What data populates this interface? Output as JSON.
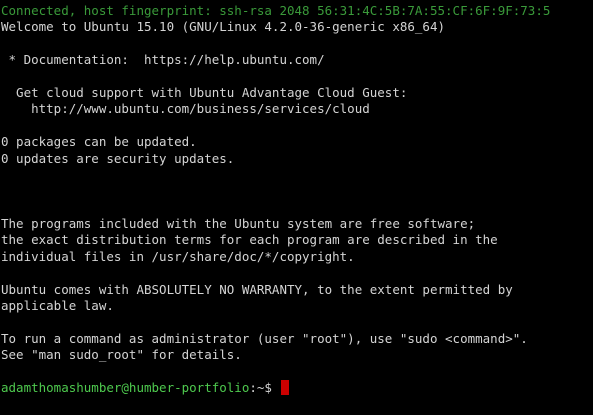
{
  "terminal": {
    "lines": [
      "Connected, host fingerprint: ssh-rsa 2048 56:31:4C:5B:7A:55:CF:6F:9F:73:5",
      "Welcome to Ubuntu 15.10 (GNU/Linux 4.2.0-36-generic x86_64)",
      "",
      " * Documentation:  https://help.ubuntu.com/",
      "",
      "  Get cloud support with Ubuntu Advantage Cloud Guest:",
      "    http://www.ubuntu.com/business/services/cloud",
      "",
      "0 packages can be updated.",
      "0 updates are security updates.",
      "",
      "",
      "",
      "The programs included with the Ubuntu system are free software;",
      "the exact distribution terms for each program are described in the",
      "individual files in /usr/share/doc/*/copyright.",
      "",
      "Ubuntu comes with ABSOLUTELY NO WARRANTY, to the extent permitted by",
      "applicable law.",
      "",
      "To run a command as administrator (user \"root\"), use \"sudo <command>\".",
      "See \"man sudo_root\" for details.",
      ""
    ],
    "prompt": {
      "user_host": "adamthomashumber@humber-portfolio",
      "separator": ":~$ "
    },
    "colors": {
      "background": "#000000",
      "text": "#d4d4d4",
      "connection_text": "#3a9a3a",
      "prompt_user": "#4ec94e",
      "cursor": "#cc0000"
    }
  }
}
